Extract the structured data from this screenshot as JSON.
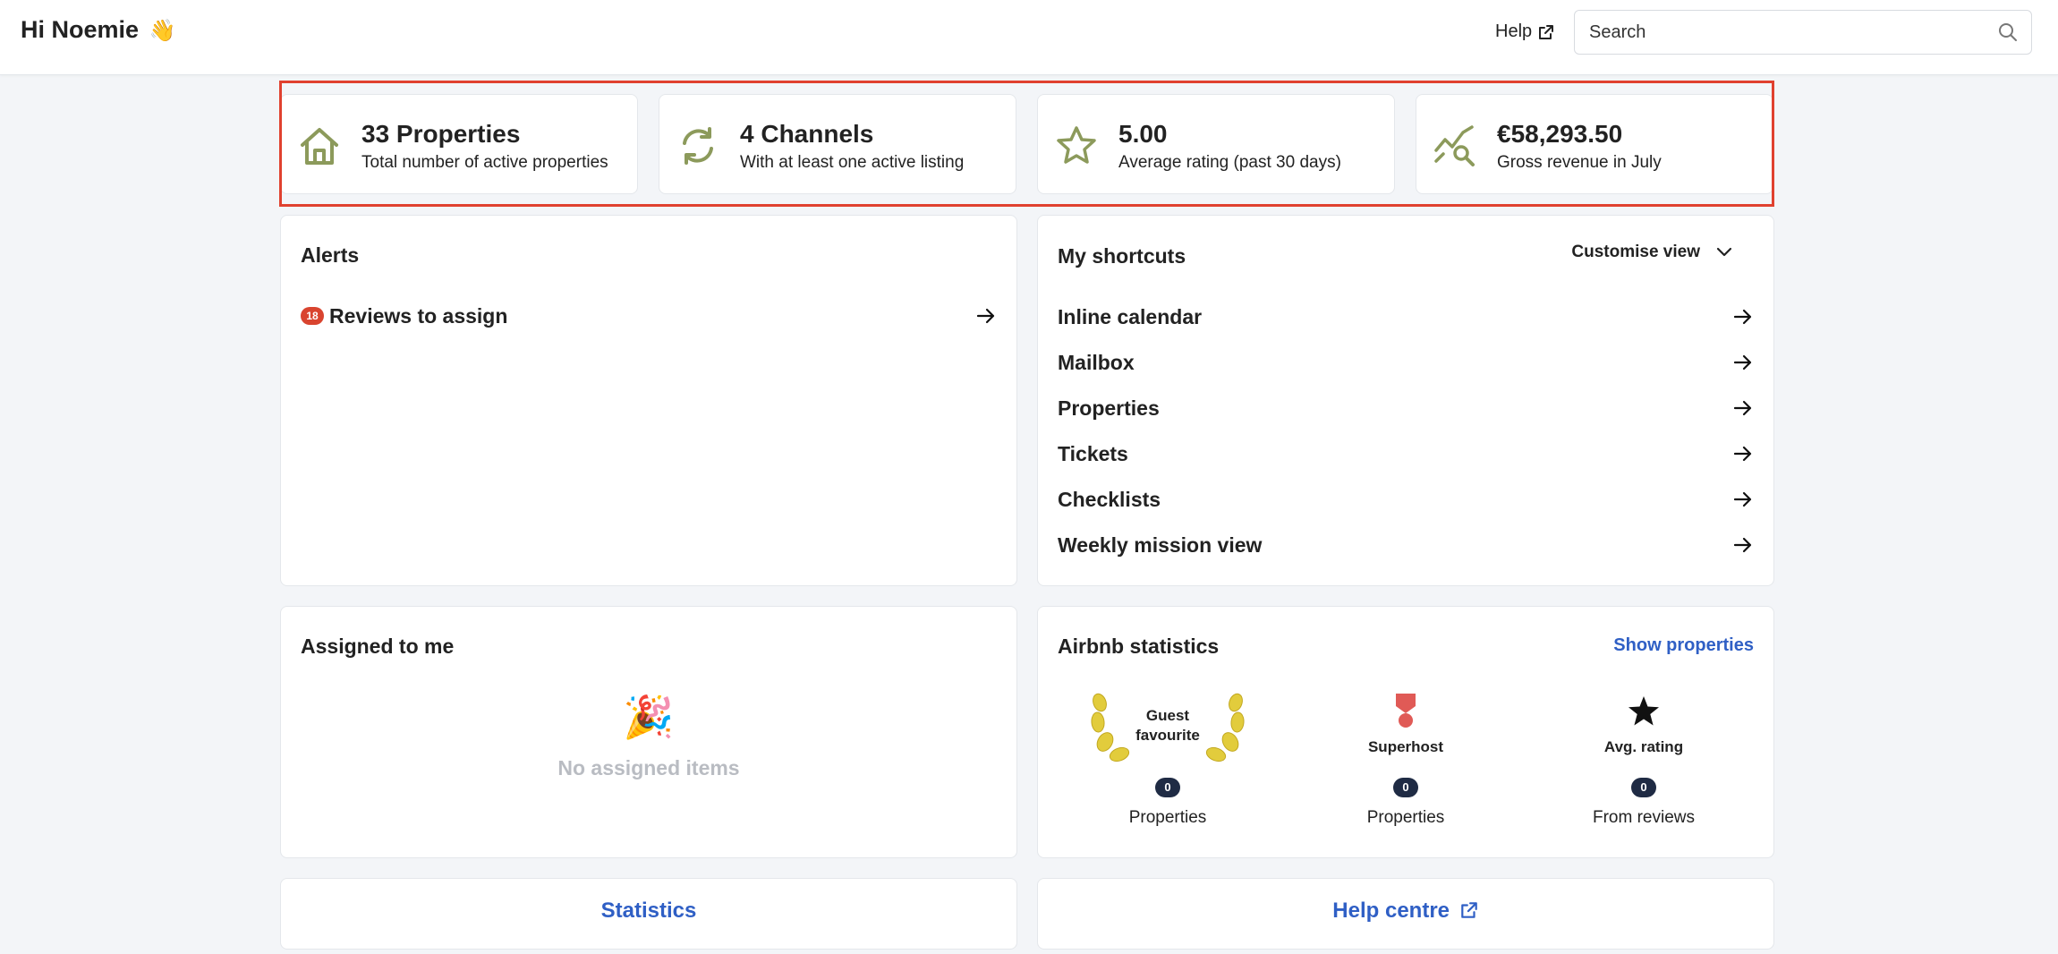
{
  "header": {
    "greeting": "Hi Noemie",
    "wave_emoji": "👋",
    "help_label": "Help",
    "search_placeholder": "Search"
  },
  "stats": [
    {
      "icon": "house-icon",
      "value": "33 Properties",
      "caption": "Total number of active properties"
    },
    {
      "icon": "sync-icon",
      "value": "4 Channels",
      "caption": "With at least one active listing"
    },
    {
      "icon": "star-outline-icon",
      "value": "5.00",
      "caption": "Average rating (past 30 days)"
    },
    {
      "icon": "revenue-chart-icon",
      "value": "€58,293.50",
      "caption": "Gross revenue in July"
    }
  ],
  "alerts": {
    "title": "Alerts",
    "items": [
      {
        "count": "18",
        "label": "Reviews to assign"
      }
    ]
  },
  "shortcuts": {
    "title": "My shortcuts",
    "customise_label": "Customise view",
    "items": [
      "Inline calendar",
      "Mailbox",
      "Properties",
      "Tickets",
      "Checklists",
      "Weekly mission view"
    ]
  },
  "assigned": {
    "title": "Assigned to me",
    "empty_emoji": "🎉",
    "empty_text": "No assigned items"
  },
  "airbnb": {
    "title": "Airbnb statistics",
    "show_properties": "Show properties",
    "columns": [
      {
        "title_line1": "Guest",
        "title_line2": "favourite",
        "count": "0",
        "sub": "Properties"
      },
      {
        "title": "Superhost",
        "count": "0",
        "sub": "Properties"
      },
      {
        "title": "Avg. rating",
        "count": "0",
        "sub": "From reviews"
      }
    ]
  },
  "footer": {
    "statistics": "Statistics",
    "help_centre": "Help centre"
  },
  "colors": {
    "accent_red": "#e0412f",
    "icon_olive": "#8c9a5b",
    "link_blue": "#2f5fc5",
    "badge_navy": "#1f2b44"
  }
}
